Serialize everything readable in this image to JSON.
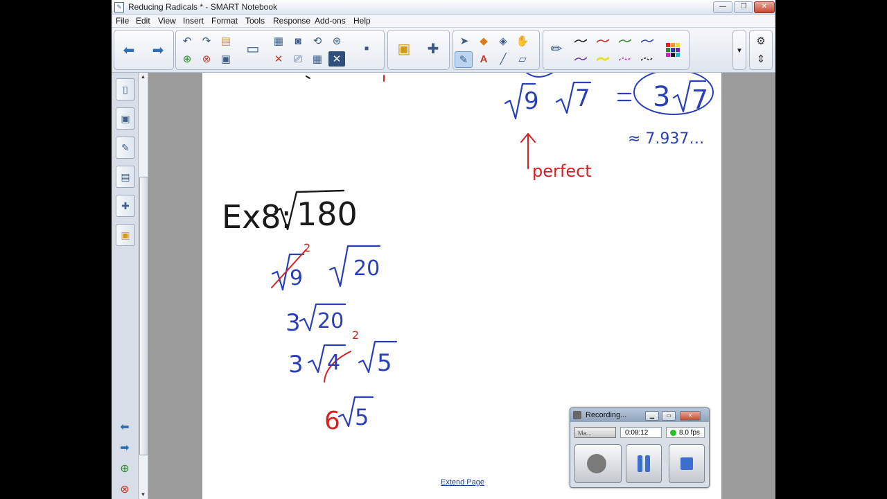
{
  "window": {
    "title": "Reducing Radicals * - SMART Notebook",
    "min": "—",
    "max": "❐",
    "close": "✕"
  },
  "menu": [
    "File",
    "Edit",
    "View",
    "Insert",
    "Format",
    "Tools",
    "Response",
    "Add-ons",
    "Help"
  ],
  "toolbar": {
    "back": "⬅",
    "forward": "➡",
    "undo": "↶",
    "redo": "↷",
    "pen_colors": [
      "#1a1a1a",
      "#d22222",
      "#2a8a2a",
      "#2a3eb8",
      "#6e2aa8",
      "#e8e020",
      "#d020c8",
      "#1a1a1a"
    ]
  },
  "sidebar": {
    "tabs": [
      "page-sorter",
      "gallery",
      "attachments",
      "properties",
      "add-ons",
      "response"
    ]
  },
  "canvas": {
    "top_right": {
      "radical_9": "9",
      "radical_7": "7",
      "equals": "=",
      "result_coef": "3",
      "result_rad": "7",
      "approx": "≈ 7.937…",
      "label": "perfect"
    },
    "ex8_label": "Ex8:",
    "ex8_radicand": "180",
    "step1": {
      "r1": "9",
      "r1_note": "2",
      "r2": "20"
    },
    "step2": {
      "coef": "3",
      "rad": "20"
    },
    "step3": {
      "coef": "3",
      "r1": "4",
      "r1_note": "2",
      "r2": "5"
    },
    "final": {
      "coef": "6",
      "rad": "5"
    }
  },
  "extend_page": "Extend Page",
  "recorder": {
    "title": "Recording...",
    "preset": "Ma...",
    "time": "0:08:12",
    "fps": "8.0 fps"
  }
}
